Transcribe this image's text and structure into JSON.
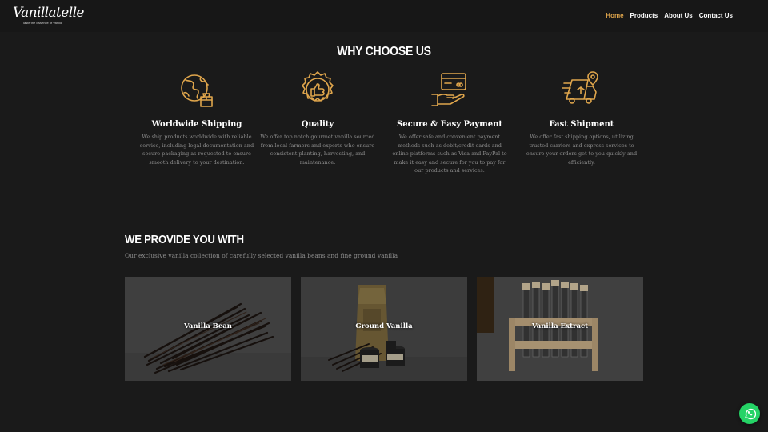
{
  "brand": {
    "name": "Vanillatelle",
    "tagline": "Taste the Essence of Vanilla"
  },
  "nav": [
    {
      "label": "Home",
      "active": true
    },
    {
      "label": "Products"
    },
    {
      "label": "About Us"
    },
    {
      "label": "Contact Us"
    }
  ],
  "why": {
    "title": "WHY CHOOSE US",
    "features": [
      {
        "icon": "globe-package-icon",
        "title": "Worldwide Shipping",
        "text": "We ship products worldwide with reliable service, including legal documentation and secure packaging as requested to ensure smooth delivery to your destination."
      },
      {
        "icon": "quality-badge-icon",
        "title": "Quality",
        "text": "We offer top notch gourmet vanilla sourced from local farmers and experts who ensure consistent planting, harvesting, and maintenance."
      },
      {
        "icon": "card-hand-icon",
        "title": "Secure & Easy Payment",
        "text": "We offer safe and convenient payment methods such as debit/credit cards and online platforms such as Visa and PayPal to make it easy and secure for you to pay for our products and services."
      },
      {
        "icon": "delivery-truck-icon",
        "title": "Fast Shipment",
        "text": "We offer fast shipping options, utilizing trusted carriers and express services to ensure your orders get to you quickly and efficiently."
      }
    ]
  },
  "provide": {
    "title": "WE PROVIDE YOU WITH",
    "subtitle": "Our exclusive vanilla collection of carefully selected vanilla beans and fine ground vanilla",
    "cards": [
      {
        "label": "Vanilla Bean"
      },
      {
        "label": "Ground Vanilla"
      },
      {
        "label": "Vanilla Extract"
      }
    ]
  },
  "colors": {
    "background": "#1a1a1a",
    "accent": "#e0a64c",
    "whatsapp": "#25d366"
  },
  "whatsapp_icon": "whatsapp-icon"
}
